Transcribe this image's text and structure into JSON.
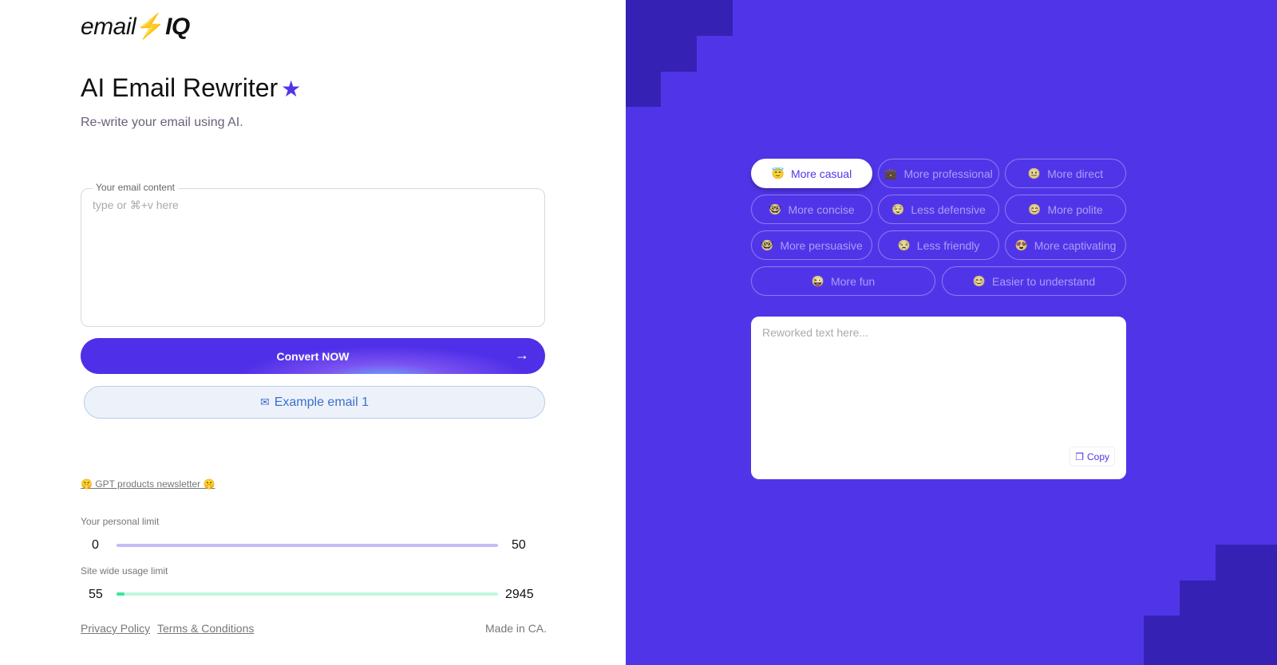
{
  "brand": {
    "logo_text": "email⚡IQ",
    "accent": "#5035e8"
  },
  "header": {
    "title": "AI Email Rewriter",
    "subtitle": "Re-write your email using AI."
  },
  "email_input": {
    "label": "Your email content",
    "placeholder": "type or ⌘+v here",
    "value": ""
  },
  "convert_button": {
    "label": "Convert NOW",
    "icon": "arrow-right-icon"
  },
  "example_button": {
    "label": "Example email 1",
    "icon": "mail-icon"
  },
  "newsletter": {
    "label": "🤫 GPT products newsletter 🤫"
  },
  "limits": {
    "personal": {
      "label": "Your personal limit",
      "used": "0",
      "max": "50",
      "fraction": 0
    },
    "site": {
      "label": "Site wide usage limit",
      "used": "55",
      "max": "2945",
      "fraction": 0.0187
    }
  },
  "footer": {
    "privacy": "Privacy Policy",
    "terms": "Terms & Conditions",
    "made_in": "Made in CA."
  },
  "tones": [
    {
      "label": "More casual",
      "emoji": "😇",
      "active": true
    },
    {
      "label": "More professional",
      "emoji": "💼",
      "active": false
    },
    {
      "label": "More direct",
      "emoji": "😐",
      "active": false
    },
    {
      "label": "More concise",
      "emoji": "🤓",
      "active": false
    },
    {
      "label": "Less defensive",
      "emoji": "😌",
      "active": false
    },
    {
      "label": "More polite",
      "emoji": "😊",
      "active": false
    },
    {
      "label": "More persuasive",
      "emoji": "🤓",
      "active": false
    },
    {
      "label": "Less friendly",
      "emoji": "😒",
      "active": false
    },
    {
      "label": "More captivating",
      "emoji": "😍",
      "active": false
    },
    {
      "label": "More fun",
      "emoji": "😜",
      "active": false
    },
    {
      "label": "Easier to understand",
      "emoji": "😊",
      "active": false
    }
  ],
  "output": {
    "placeholder": "Reworked text here...",
    "value": "",
    "copy_label": "Copy"
  }
}
